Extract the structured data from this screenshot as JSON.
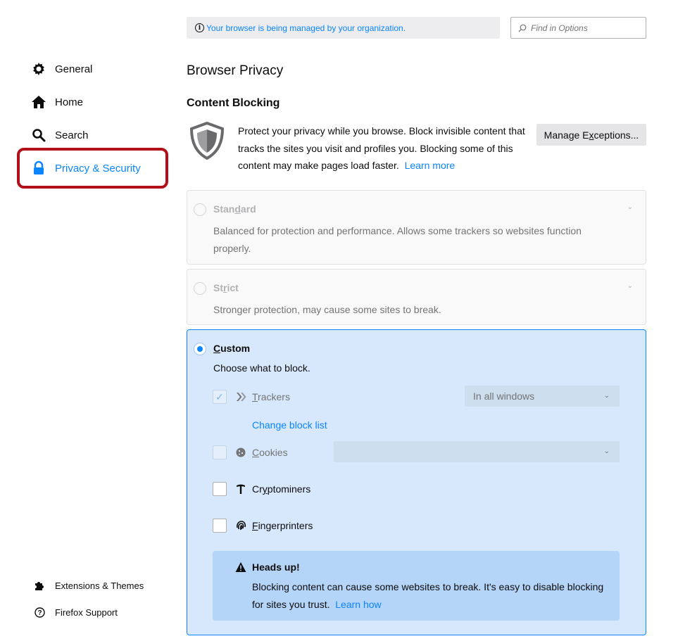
{
  "sidebar": {
    "items": [
      {
        "label": "General",
        "icon": "gear-icon"
      },
      {
        "label": "Home",
        "icon": "home-icon"
      },
      {
        "label": "Search",
        "icon": "search-icon"
      },
      {
        "label": "Privacy & Security",
        "icon": "lock-icon",
        "active": true
      }
    ],
    "footer": [
      {
        "label": "Extensions & Themes",
        "icon": "puzzle-icon"
      },
      {
        "label": "Firefox Support",
        "icon": "help-icon"
      }
    ]
  },
  "header": {
    "managed_notice": "Your browser is being managed by your organization.",
    "find_placeholder": "Find in Options"
  },
  "page": {
    "title": "Browser Privacy",
    "section_title": "Content Blocking",
    "description": "Protect your privacy while you browse. Block invisible content that tracks the sites you visit and profiles you. Blocking some of this content may make pages load faster.",
    "learn_more": "Learn more",
    "manage_exceptions": {
      "pre": "Manage E",
      "accel": "x",
      "post": "ceptions..."
    }
  },
  "options": {
    "standard": {
      "title_pre": "Stan",
      "title_accel": "d",
      "title_post": "ard",
      "description": "Balanced for protection and performance. Allows some trackers so websites function properly."
    },
    "strict": {
      "title_pre": "St",
      "title_accel": "r",
      "title_post": "ict",
      "description": "Stronger protection, may cause some sites to break."
    },
    "custom": {
      "title_accel": "C",
      "title_post": "ustom",
      "subtitle": "Choose what to block.",
      "trackers": {
        "accel": "T",
        "post": "rackers",
        "checked": true,
        "select_value": "In all windows"
      },
      "change_block_list": "Change block list",
      "cookies": {
        "accel": "C",
        "post": "ookies",
        "checked": false,
        "select_value": ""
      },
      "cryptominers": {
        "pre": "Cr",
        "accel": "y",
        "post": "ptominers",
        "checked": false
      },
      "fingerprinters": {
        "accel": "F",
        "post": "ingerprinters",
        "checked": false
      }
    }
  },
  "warning": {
    "title": "Heads up!",
    "text": "Blocking content can cause some websites to break. It's easy to disable blocking for sites you trust.",
    "link": "Learn how"
  },
  "colors": {
    "accent": "#0a84ff",
    "highlight_border": "#b1101b",
    "selected_card": "#d7e8fc"
  }
}
